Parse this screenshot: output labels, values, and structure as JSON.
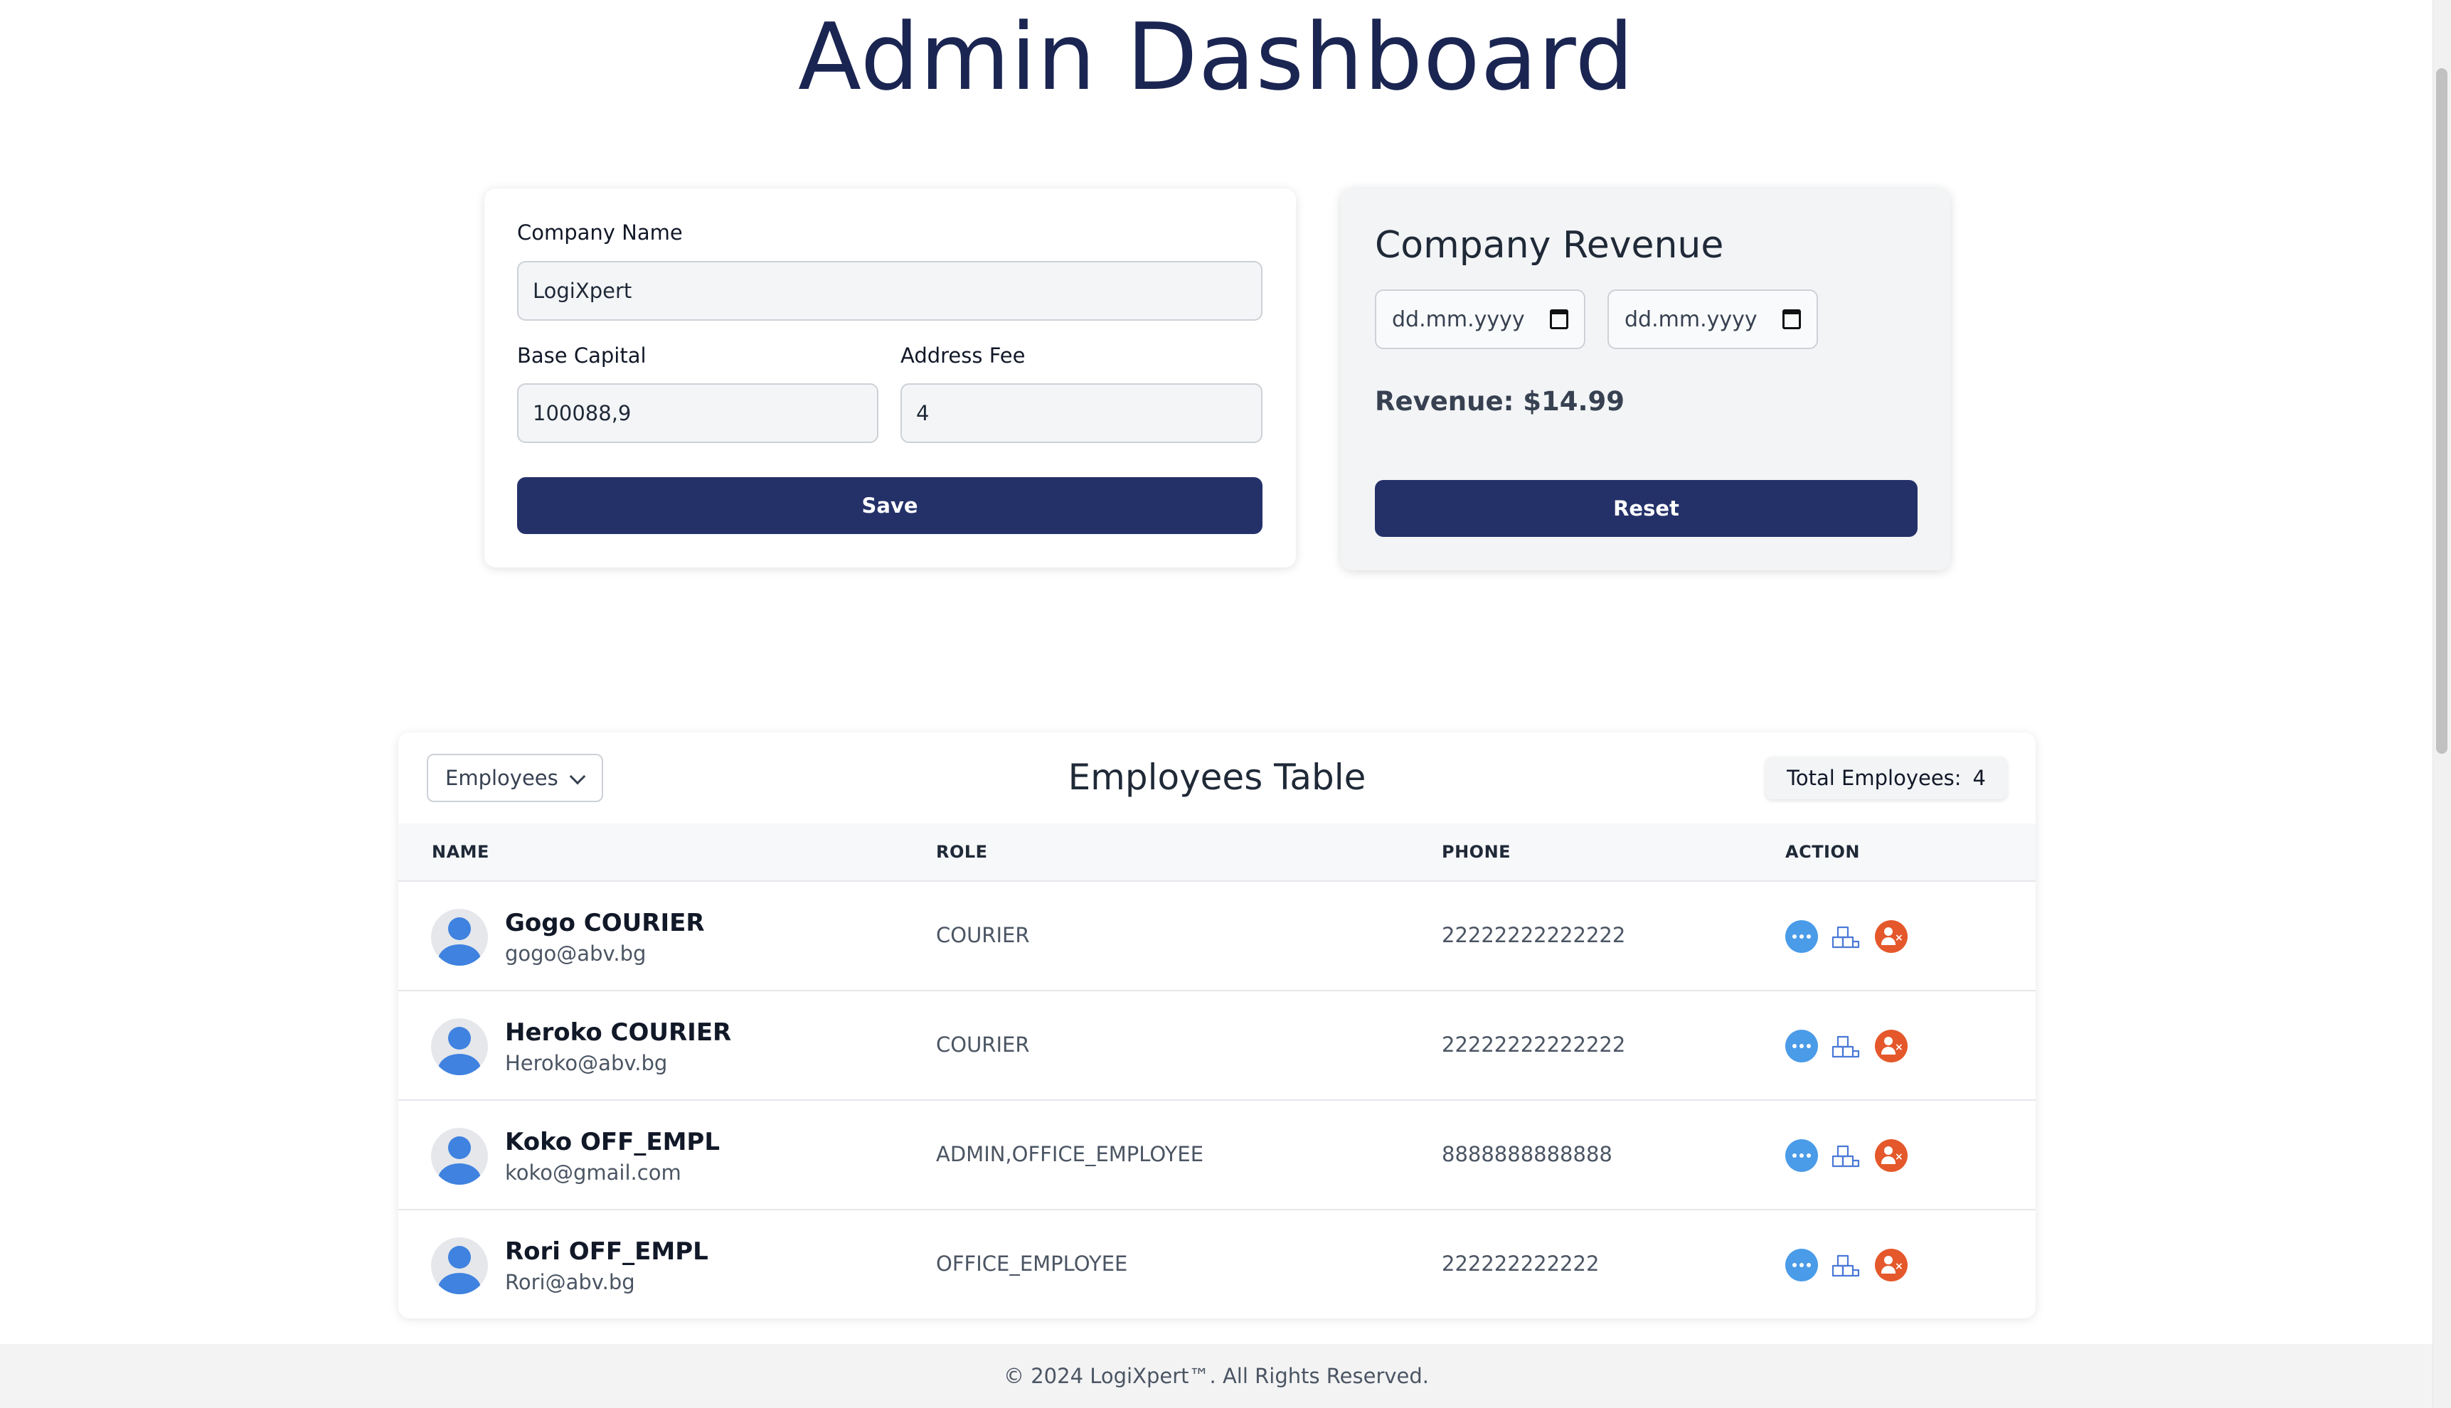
{
  "page": {
    "title": "Admin Dashboard"
  },
  "company_form": {
    "company_name_label": "Company Name",
    "company_name_value": "LogiXpert",
    "base_capital_label": "Base Capital",
    "base_capital_value": "100088,9",
    "address_fee_label": "Address Fee",
    "address_fee_value": "4",
    "save_label": "Save"
  },
  "revenue": {
    "title": "Company Revenue",
    "start_date_placeholder": "dd.mm.yyyy",
    "end_date_placeholder": "dd.mm.yyyy",
    "revenue_text": "Revenue: $14.99",
    "reset_label": "Reset"
  },
  "employees_table": {
    "filter_selected": "Employees",
    "title": "Employees Table",
    "total_label": "Total Employees:",
    "total_count": "4",
    "columns": [
      "NAME",
      "ROLE",
      "PHONE",
      "ACTION"
    ],
    "rows": [
      {
        "name": "Gogo COURIER",
        "email": "gogo@abv.bg",
        "role": "COURIER",
        "phone": "22222222222222"
      },
      {
        "name": "Heroko COURIER",
        "email": "Heroko@abv.bg",
        "role": "COURIER",
        "phone": "22222222222222"
      },
      {
        "name": "Koko OFF_EMPL",
        "email": "koko@gmail.com",
        "role": "ADMIN,OFFICE_EMPLOYEE",
        "phone": "8888888888888"
      },
      {
        "name": "Rori OFF_EMPL",
        "email": "Rori@abv.bg",
        "role": "OFFICE_EMPLOYEE",
        "phone": "222222222222"
      }
    ],
    "action_icons": [
      "details-icon",
      "assign-icon",
      "remove-user-icon"
    ]
  },
  "footer": {
    "text": "© 2024 LogiXpert™. All Rights Reserved."
  },
  "colors": {
    "title": "#1b2552",
    "primary_button": "#243169",
    "info_icon": "#4a9be8",
    "delete_icon": "#e4582b",
    "avatar": "#3f82e0"
  }
}
